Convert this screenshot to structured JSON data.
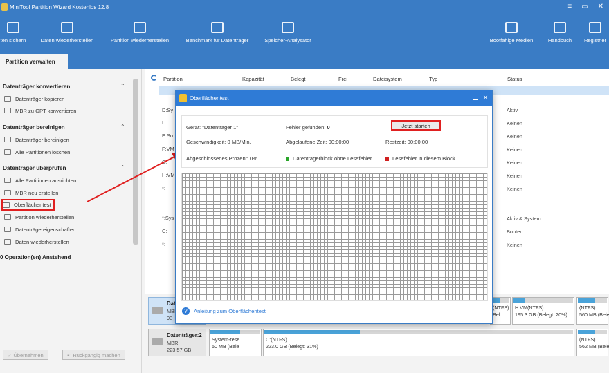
{
  "app": {
    "title": "MiniTool Partition Wizard Kostenlos 12.8",
    "controls": [
      "≡",
      "▭",
      "✕"
    ]
  },
  "toolbar": [
    {
      "label": "ten sichern",
      "icon": "backup-icon"
    },
    {
      "label": "Daten wiederherstellen",
      "icon": "data-recovery-icon"
    },
    {
      "label": "Partition wiederherstellen",
      "icon": "partition-recovery-icon"
    },
    {
      "label": "Benchmark für Datenträger",
      "icon": "benchmark-icon"
    },
    {
      "label": "Speicher-Analysator",
      "icon": "space-analyzer-icon"
    },
    {
      "label": "Bootfähige Medien",
      "icon": "bootable-media-icon"
    },
    {
      "label": "Handbuch",
      "icon": "manual-icon"
    },
    {
      "label": "Registrier",
      "icon": "register-icon"
    }
  ],
  "tab": {
    "label": "Partition verwalten"
  },
  "sidebar": {
    "sections": [
      {
        "title": "Datenträger konvertieren",
        "items": [
          "Datenträger kopieren",
          "MBR zu GPT konvertieren"
        ]
      },
      {
        "title": "Datenträger bereinigen",
        "items": [
          "Datenträger bereinigen",
          "Alle Partitionen löschen"
        ]
      },
      {
        "title": "Datenträger überprüfen",
        "items": [
          "Alle Partitionen ausrichten",
          "MBR neu erstellen",
          "Oberflächentest",
          "Partition wiederherstellen",
          "Datenträgereigenschaften",
          "Daten wiederherstellen"
        ]
      }
    ],
    "pending": "0 Operation(en) Anstehend",
    "apply_label": "✓ Übernehmen",
    "undo_label": "↶ Rückgängig machen"
  },
  "table": {
    "headers": [
      "Partition",
      "Kapazität",
      "Belegt",
      "Frei",
      "Dateisystem",
      "Typ",
      "Status"
    ],
    "partition_fragments": [
      "D:Sy",
      "I:",
      "E:So",
      "F:VM",
      "G:",
      "H:VM",
      "*:",
      "",
      "*:Sys",
      "C:",
      "*:"
    ],
    "status": [
      "",
      "Aktiv",
      "Keinen",
      "Keinen",
      "Keinen",
      "Keinen",
      "Keinen",
      "Keinen",
      "",
      "Aktiv & System",
      "Booten",
      "Keinen"
    ]
  },
  "disks": [
    {
      "name": "Dat",
      "sub1": "MBR",
      "sub2": "93",
      "parts": [
        {
          "t1": "(NTFS)",
          "t2": "Bel",
          "fill": 0.5
        },
        {
          "t1": "H:VM(NTFS)",
          "t2": "195.3 GB (Belegt: 20%)",
          "fill": 0.2
        },
        {
          "t1": "(NTFS)",
          "t2": "560 MB (Bele",
          "fill": 0.6
        }
      ]
    },
    {
      "name": "Datenträger:2",
      "sub1": "MBR",
      "sub2": "223.57 GB",
      "parts": [
        {
          "t1": "System-rese",
          "t2": "50 MB (Bele",
          "fill": 0.6
        },
        {
          "t1": "C:(NTFS)",
          "t2": "223.0 GB (Belegt: 31%)",
          "fill": 0.31
        },
        {
          "t1": "(NTFS)",
          "t2": "562 MB (Bele",
          "fill": 0.6
        }
      ]
    }
  ],
  "dialog": {
    "title": "Oberflächentest",
    "device_label": "Gerät:",
    "device_value": "\"Datenträger 1\"",
    "errors_label": "Fehler gefunden:",
    "errors_value": "0",
    "start_button": "Jetzt starten",
    "speed_label": "Geschwindigkeit:",
    "speed_value": "0 MB/Min.",
    "elapsed_label": "Abgelaufene Zeit:",
    "elapsed_value": "00:00:00",
    "remaining_label": "Restzeit:",
    "remaining_value": "00:00:00",
    "percent_label": "Abgeschlossenes Prozent:",
    "percent_value": "0%",
    "legend_ok": "Datenträgerblock ohne Lesefehler",
    "legend_err": "Lesefehler in diesem Block",
    "colors": {
      "ok": "#2aa52a",
      "err": "#d02020"
    },
    "help_link": "Anleitung zum Oberflächentest"
  }
}
